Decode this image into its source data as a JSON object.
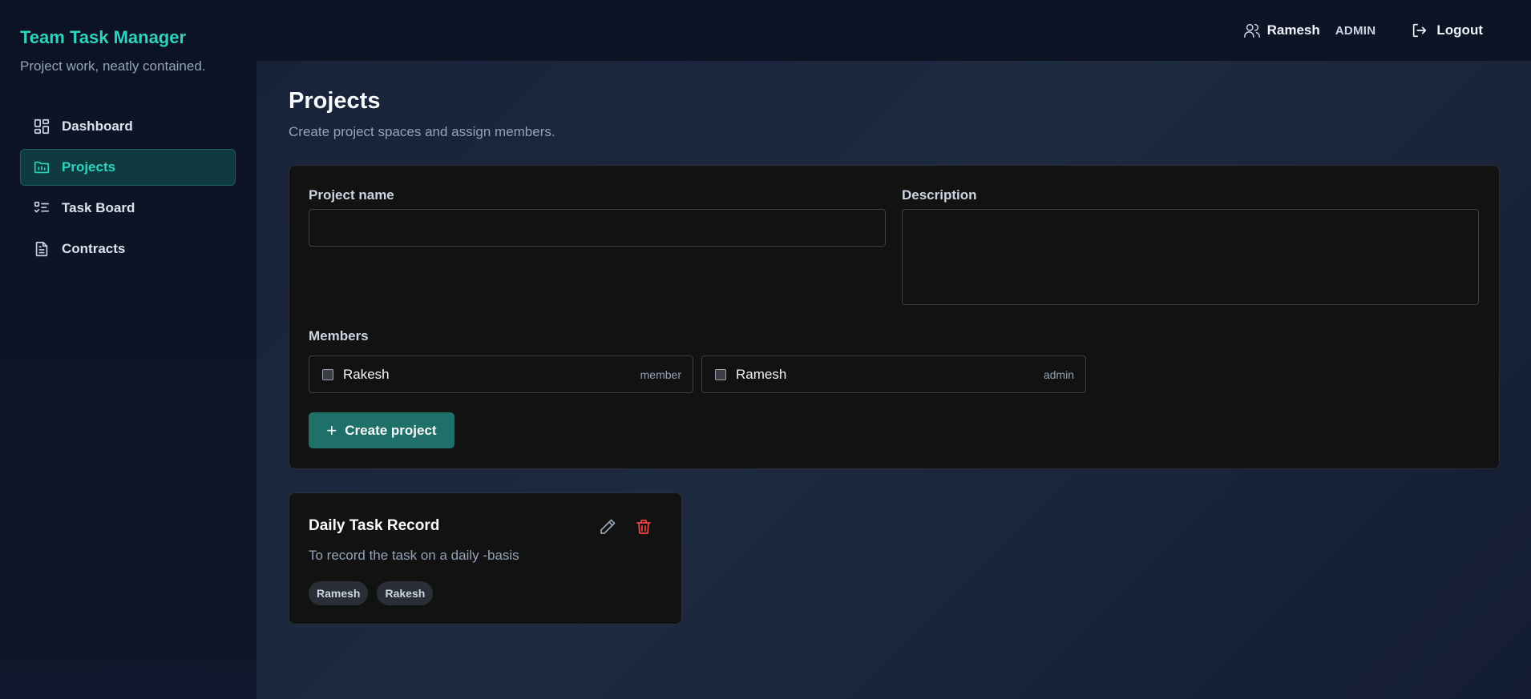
{
  "app": {
    "title": "Team Task Manager",
    "subtitle": "Project work, neatly contained."
  },
  "sidebar": {
    "items": [
      {
        "label": "Dashboard",
        "icon": "dashboard-icon",
        "active": false
      },
      {
        "label": "Projects",
        "icon": "folder-icon",
        "active": true
      },
      {
        "label": "Task Board",
        "icon": "task-list-icon",
        "active": false
      },
      {
        "label": "Contracts",
        "icon": "document-icon",
        "active": false
      }
    ]
  },
  "header": {
    "user_name": "Ramesh",
    "user_role": "ADMIN",
    "logout_label": "Logout"
  },
  "page": {
    "title": "Projects",
    "subtitle": "Create project spaces and assign members."
  },
  "form": {
    "project_name_label": "Project name",
    "project_name_value": "",
    "description_label": "Description",
    "description_value": "",
    "members_label": "Members",
    "members": [
      {
        "name": "Rakesh",
        "role": "member",
        "checked": false
      },
      {
        "name": "Ramesh",
        "role": "admin",
        "checked": false
      }
    ],
    "create_label": "Create project"
  },
  "projects": [
    {
      "title": "Daily Task Record",
      "description": "To record the task on a daily -basis",
      "members": [
        "Ramesh",
        "Rakesh"
      ]
    }
  ],
  "colors": {
    "accent": "#2dd4bf",
    "button": "#1f7068",
    "danger": "#ef4444",
    "card": "#121212"
  }
}
